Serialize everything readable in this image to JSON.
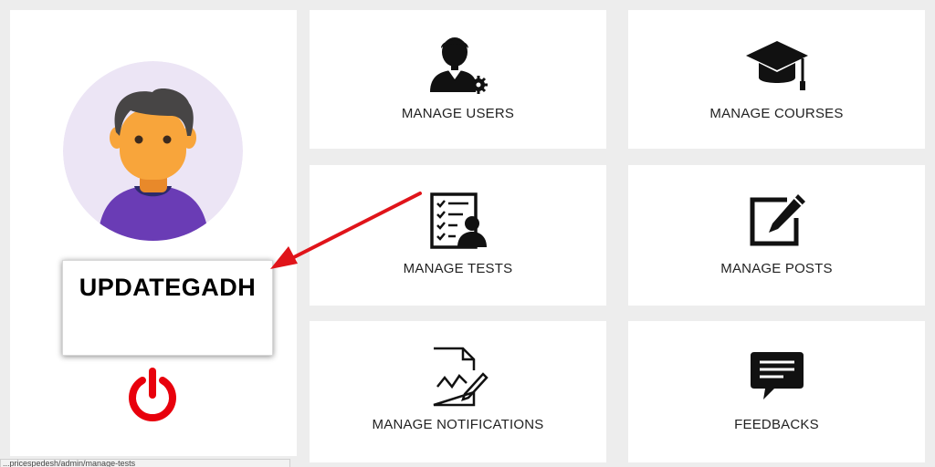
{
  "profile": {
    "username": "UPDATEGADH"
  },
  "tiles": [
    {
      "label": "MANAGE USERS",
      "icon": "manage-users-icon"
    },
    {
      "label": "MANAGE COURSES",
      "icon": "graduation-cap-icon"
    },
    {
      "label": "MANAGE TESTS",
      "icon": "test-checklist-icon"
    },
    {
      "label": "MANAGE POSTS",
      "icon": "edit-post-icon"
    },
    {
      "label": "MANAGE NOTIFICATIONS",
      "icon": "notification-document-icon"
    },
    {
      "label": "FEEDBACKS",
      "icon": "feedback-chat-icon"
    }
  ],
  "status_bar": {
    "url": "...pricespedesh/admin/manage-tests"
  },
  "colors": {
    "background": "#ededed",
    "tile": "#ffffff",
    "power": "#e8000c",
    "arrow": "#e0141a",
    "avatar_bg": "#ece5f5",
    "shirt": "#6a3cb5",
    "skin": "#f8a53b",
    "hair": "#444444"
  }
}
